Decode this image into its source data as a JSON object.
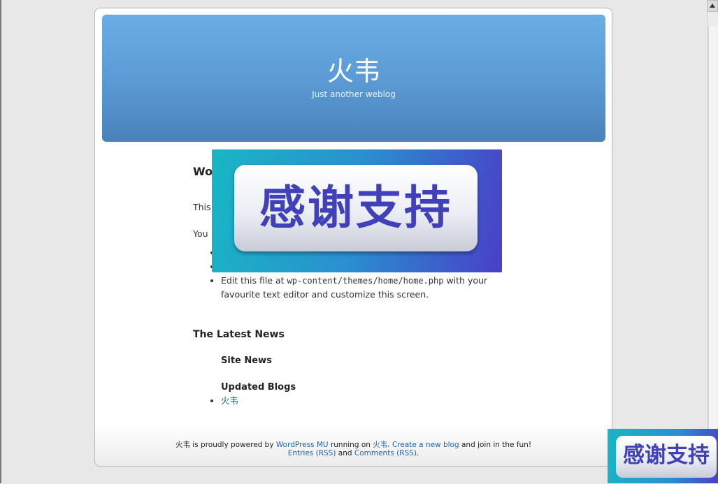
{
  "header": {
    "site_title": "火韦",
    "site_description": "Just another weblog"
  },
  "post": {
    "title_visible": "Wo",
    "paragraph1_visible": "This",
    "paragraph2_visible": "You",
    "edit_prefix": "Edit this file at ",
    "edit_code": "wp-content/themes/home/home.php",
    "edit_suffix": " with your favourite text editor and customize this screen."
  },
  "news": {
    "heading": "The Latest News",
    "site_news": "Site News",
    "updated_blogs": "Updated Blogs",
    "blogs": [
      "火韦"
    ]
  },
  "footer": {
    "site_name": "火韦",
    "text1": " is proudly powered by ",
    "wpmu_link": "WordPress MU",
    "text2": " running on ",
    "host_link": "火韦",
    "text3": ". ",
    "create_link": "Create a new blog",
    "text4": " and join in the fun!",
    "entries_link": "Entries (RSS)",
    "text5": " and ",
    "comments_link": "Comments (RSS)",
    "text6": "."
  },
  "overlays": {
    "banner_text": "感谢支持",
    "corner_text": "感谢支持"
  },
  "colors": {
    "header_top": "#6aaee5",
    "header_bottom": "#4a82bb",
    "link": "#2563a8",
    "overlay_text": "#4040b8"
  }
}
